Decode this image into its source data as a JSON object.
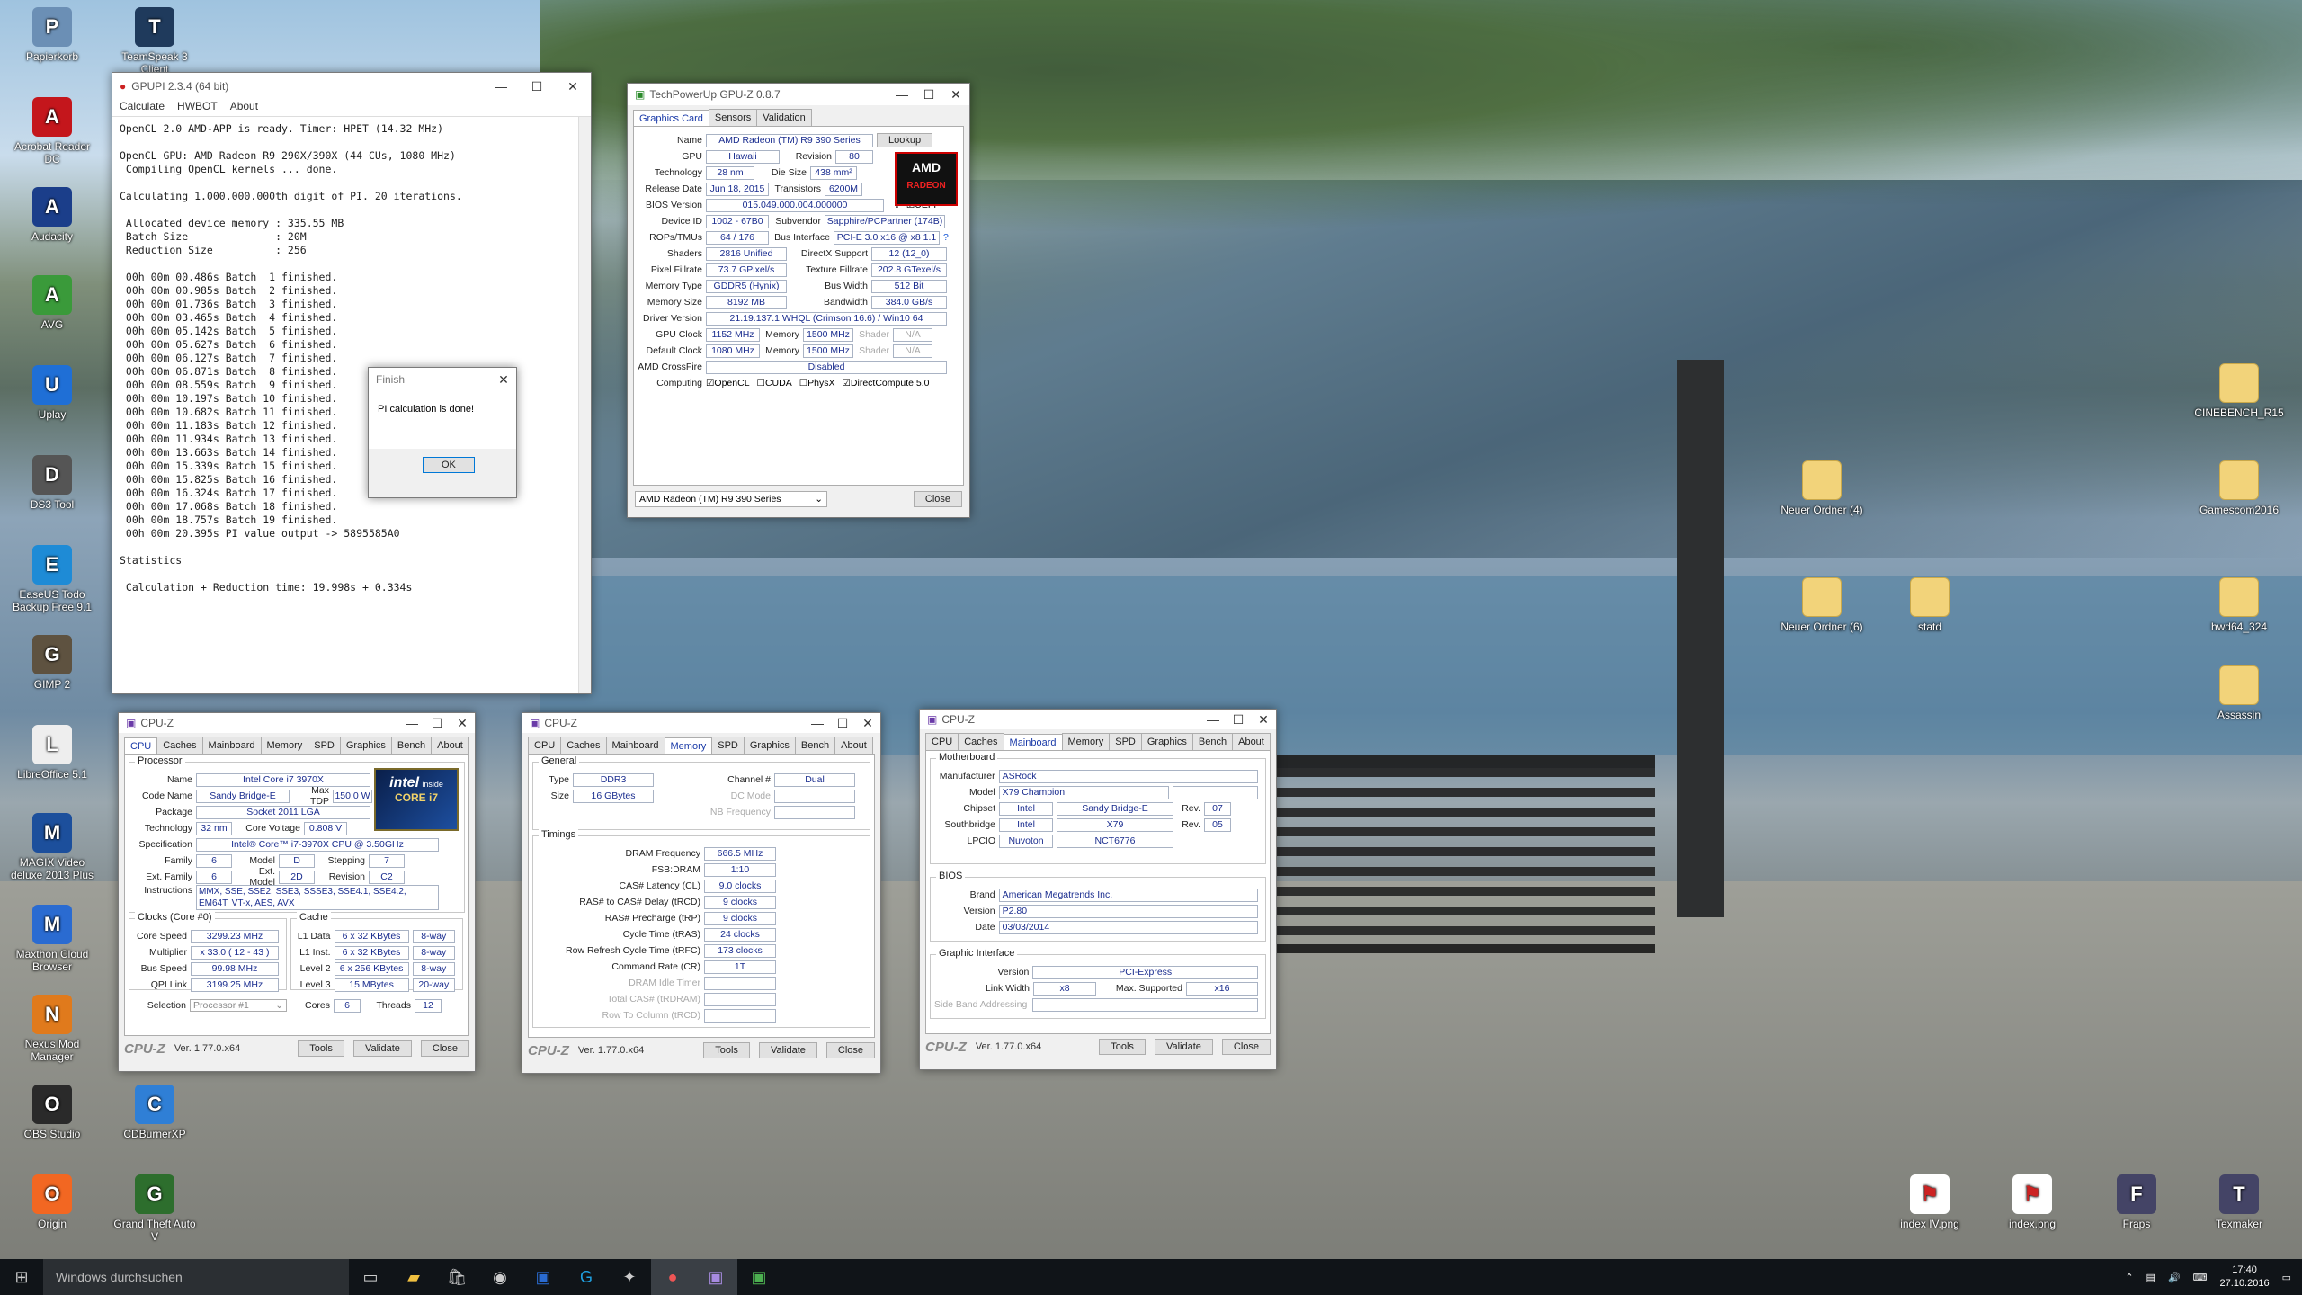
{
  "desktop": {
    "left_icons": [
      {
        "label": "Papierkorb",
        "icon": "recycle-bin-icon",
        "color": "#6b8fb5"
      },
      {
        "label": "TeamSpeak 3 Client",
        "icon": "teamspeak-icon",
        "color": "#1f3a5c"
      },
      {
        "label": "Acrobat Reader DC",
        "icon": "acrobat-icon",
        "color": "#c4161c"
      },
      {
        "label": "Audacity",
        "icon": "audacity-icon",
        "color": "#1b3e8a"
      },
      {
        "label": "AVG",
        "icon": "avg-icon",
        "color": "#3a9a3a"
      },
      {
        "label": "Uplay",
        "icon": "uplay-icon",
        "color": "#1f6fd6"
      },
      {
        "label": "DS3 Tool",
        "icon": "ds3tool-icon",
        "color": "#555555"
      },
      {
        "label": "EaseUS Todo Backup Free 9.1",
        "icon": "easeus-icon",
        "color": "#1e8bd6"
      },
      {
        "label": "GIMP 2",
        "icon": "gimp-icon",
        "color": "#5e5240"
      },
      {
        "label": "LibreOffice 5.1",
        "icon": "libreoffice-icon",
        "color": "#eeeeee"
      },
      {
        "label": "MAGIX Video deluxe 2013 Plus",
        "icon": "magix-icon",
        "color": "#1c4f9c"
      },
      {
        "label": "Maxthon Cloud Browser",
        "icon": "maxthon-icon",
        "color": "#2a6bd1"
      },
      {
        "label": "Nexus Mod Manager",
        "icon": "nexus-icon",
        "color": "#e07a1c"
      },
      {
        "label": "OBS Studio",
        "icon": "obs-icon",
        "color": "#2a2a2a"
      },
      {
        "label": "CDBurnerXP",
        "icon": "cdburnerxp-icon",
        "color": "#2f7fd6"
      },
      {
        "label": "Origin",
        "icon": "origin-icon",
        "color": "#f26722"
      },
      {
        "label": "Grand Theft Auto V",
        "icon": "gta5-icon",
        "color": "#2d6e2d"
      }
    ],
    "right_icons": [
      {
        "label": "CINEBENCH_R15",
        "icon": "folder-icon"
      },
      {
        "label": "Neuer Ordner (4)",
        "icon": "folder-icon"
      },
      {
        "label": "Gamescom2016",
        "icon": "folder-icon"
      },
      {
        "label": "Neuer Ordner (6)",
        "icon": "folder-icon"
      },
      {
        "label": "statd",
        "icon": "folder-icon"
      },
      {
        "label": "hwd64_324",
        "icon": "folder-icon"
      },
      {
        "label": "Assassin",
        "icon": "folder-icon"
      },
      {
        "label": "index IV.png",
        "icon": "image-file-icon"
      },
      {
        "label": "index.png",
        "icon": "image-file-icon"
      },
      {
        "label": "Fraps",
        "icon": "fraps-icon"
      },
      {
        "label": "Texmaker",
        "icon": "texmaker-icon"
      }
    ]
  },
  "gpupi": {
    "title": "GPUPI 2.3.4 (64 bit)",
    "menu": [
      "Calculate",
      "HWBOT",
      "About"
    ],
    "log": "OpenCL 2.0 AMD-APP is ready. Timer: HPET (14.32 MHz)\n\nOpenCL GPU: AMD Radeon R9 290X/390X (44 CUs, 1080 MHz)\n Compiling OpenCL kernels ... done.\n\nCalculating 1.000.000.000th digit of PI. 20 iterations.\n\n Allocated device memory : 335.55 MB\n Batch Size              : 20M\n Reduction Size          : 256\n\n 00h 00m 00.486s Batch  1 finished.\n 00h 00m 00.985s Batch  2 finished.\n 00h 00m 01.736s Batch  3 finished.\n 00h 00m 03.465s Batch  4 finished.\n 00h 00m 05.142s Batch  5 finished.\n 00h 00m 05.627s Batch  6 finished.\n 00h 00m 06.127s Batch  7 finished.\n 00h 00m 06.871s Batch  8 finished.\n 00h 00m 08.559s Batch  9 finished.\n 00h 00m 10.197s Batch 10 finished.\n 00h 00m 10.682s Batch 11 finished.\n 00h 00m 11.183s Batch 12 finished.\n 00h 00m 11.934s Batch 13 finished.\n 00h 00m 13.663s Batch 14 finished.\n 00h 00m 15.339s Batch 15 finished.\n 00h 00m 15.825s Batch 16 finished.\n 00h 00m 16.324s Batch 17 finished.\n 00h 00m 17.068s Batch 18 finished.\n 00h 00m 18.757s Batch 19 finished.\n 00h 00m 20.395s PI value output -> 5895585A0\n\nStatistics\n\n Calculation + Reduction time: 19.998s + 0.334s"
  },
  "finish_dialog": {
    "title": "Finish",
    "message": "PI calculation is done!",
    "ok": "OK"
  },
  "gpuz": {
    "title": "TechPowerUp GPU-Z 0.8.7",
    "tabs": [
      "Graphics Card",
      "Sensors",
      "Validation"
    ],
    "name": "AMD Radeon (TM) R9 390 Series",
    "lookup": "Lookup",
    "gpu": "Hawaii",
    "revision": "80",
    "technology": "28 nm",
    "die_size": "438 mm²",
    "release_date": "Jun 18, 2015",
    "transistors": "6200M",
    "bios_version": "015.049.000.004.000000",
    "uefi": "UEFI",
    "device_id": "1002 - 67B0",
    "subvendor": "Sapphire/PCPartner (174B)",
    "rops_tmus": "64 / 176",
    "bus_interface": "PCI-E 3.0 x16 @ x8 1.1",
    "shaders": "2816 Unified",
    "directx_support": "12 (12_0)",
    "pixel_fillrate": "73.7 GPixel/s",
    "texture_fillrate": "202.8 GTexel/s",
    "memory_type": "GDDR5 (Hynix)",
    "bus_width": "512 Bit",
    "memory_size": "8192 MB",
    "bandwidth": "384.0 GB/s",
    "driver_version": "21.19.137.1 WHQL (Crimson 16.6) / Win10 64",
    "gpu_clock": "1152 MHz",
    "memory_clock": "1500 MHz",
    "default_clock": "1080 MHz",
    "default_memory": "1500 MHz",
    "shader_na": "N/A",
    "crossfire": "Disabled",
    "computing": [
      "OpenCL",
      "CUDA",
      "PhysX",
      "DirectCompute 5.0"
    ],
    "selected_card": "AMD Radeon (TM) R9 390 Series",
    "close": "Close",
    "labels": {
      "name": "Name",
      "gpu": "GPU",
      "revision": "Revision",
      "technology": "Technology",
      "die_size": "Die Size",
      "release_date": "Release Date",
      "transistors": "Transistors",
      "bios_version": "BIOS Version",
      "device_id": "Device ID",
      "subvendor": "Subvendor",
      "rops_tmus": "ROPs/TMUs",
      "bus_interface": "Bus Interface",
      "shaders": "Shaders",
      "directx_support": "DirectX Support",
      "pixel_fillrate": "Pixel Fillrate",
      "texture_fillrate": "Texture Fillrate",
      "memory_type": "Memory Type",
      "bus_width": "Bus Width",
      "memory_size": "Memory Size",
      "bandwidth": "Bandwidth",
      "driver_version": "Driver Version",
      "gpu_clock": "GPU Clock",
      "memory": "Memory",
      "shader": "Shader",
      "default_clock": "Default Clock",
      "crossfire": "AMD CrossFire",
      "computing": "Computing"
    }
  },
  "cpuz_common": {
    "title": "CPU-Z",
    "tabs": [
      "CPU",
      "Caches",
      "Mainboard",
      "Memory",
      "SPD",
      "Graphics",
      "Bench",
      "About"
    ],
    "version": "Ver. 1.77.0.x64",
    "tools": "Tools",
    "validate": "Validate",
    "close": "Close",
    "logo": "CPU-Z"
  },
  "cpuz_cpu": {
    "processor": "Processor",
    "name": "Intel Core i7 3970X",
    "code_name": "Sandy Bridge-E",
    "max_tdp": "150.0 W",
    "package": "Socket 2011 LGA",
    "technology": "32 nm",
    "core_voltage": "0.808 V",
    "specification": "Intel® Core™ i7-3970X CPU @ 3.50GHz",
    "family": "6",
    "model": "D",
    "stepping": "7",
    "ext_family": "6",
    "ext_model": "2D",
    "revision": "C2",
    "instructions": "MMX, SSE, SSE2, SSE3, SSSE3, SSE4.1, SSE4.2, EM64T, VT-x, AES, AVX",
    "clocks_title": "Clocks (Core #0)",
    "core_speed": "3299.23 MHz",
    "multiplier": "x 33.0 ( 12 - 43 )",
    "bus_speed": "99.98 MHz",
    "qpi_link": "3199.25 MHz",
    "cache_title": "Cache",
    "l1_data": "6 x 32 KBytes",
    "l1_data_way": "8-way",
    "l1_inst": "6 x 32 KBytes",
    "l1_inst_way": "8-way",
    "level2": "6 x 256 KBytes",
    "level2_way": "8-way",
    "level3": "15 MBytes",
    "level3_way": "20-way",
    "selection": "Processor #1",
    "cores": "6",
    "threads": "12",
    "badge_line1": "intel",
    "badge_line2": "inside",
    "badge_line3": "CORE i7",
    "labels": {
      "name": "Name",
      "code_name": "Code Name",
      "max_tdp": "Max TDP",
      "package": "Package",
      "technology": "Technology",
      "core_voltage": "Core Voltage",
      "specification": "Specification",
      "family": "Family",
      "model": "Model",
      "stepping": "Stepping",
      "ext_family": "Ext. Family",
      "ext_model": "Ext. Model",
      "revision": "Revision",
      "instructions": "Instructions",
      "core_speed": "Core Speed",
      "multiplier": "Multiplier",
      "bus_speed": "Bus Speed",
      "qpi_link": "QPI Link",
      "l1_data": "L1 Data",
      "l1_inst": "L1 Inst.",
      "level2": "Level 2",
      "level3": "Level 3",
      "selection": "Selection",
      "cores": "Cores",
      "threads": "Threads"
    }
  },
  "cpuz_memory": {
    "general": "General",
    "type": "DDR3",
    "size": "16 GBytes",
    "channel": "Dual",
    "timings": "Timings",
    "dram_frequency": "666.5 MHz",
    "fsb_dram": "1:10",
    "cas_latency": "9.0 clocks",
    "ras_to_cas": "9 clocks",
    "ras_precharge": "9 clocks",
    "cycle_time": "24 clocks",
    "row_refresh": "173 clocks",
    "command_rate": "1T",
    "labels": {
      "type": "Type",
      "size": "Size",
      "channel": "Channel #",
      "dc_mode": "DC Mode",
      "nb_frequency": "NB Frequency",
      "dram_frequency": "DRAM Frequency",
      "fsb_dram": "FSB:DRAM",
      "cas_latency": "CAS# Latency (CL)",
      "ras_to_cas": "RAS# to CAS# Delay (tRCD)",
      "ras_precharge": "RAS# Precharge (tRP)",
      "cycle_time": "Cycle Time (tRAS)",
      "row_refresh": "Row Refresh Cycle Time (tRFC)",
      "command_rate": "Command Rate (CR)",
      "idle_timer": "DRAM Idle Timer",
      "total_cas": "Total CAS# (tRDRAM)",
      "row_to_column": "Row To Column (tRCD)"
    }
  },
  "cpuz_mainboard": {
    "motherboard": "Motherboard",
    "manufacturer": "ASRock",
    "model": "X79 Champion",
    "chipset_vendor": "Intel",
    "chipset": "Sandy Bridge-E",
    "chipset_rev": "07",
    "southbridge_vendor": "Intel",
    "southbridge": "X79",
    "southbridge_rev": "05",
    "lpcio_vendor": "Nuvoton",
    "lpcio": "NCT6776",
    "bios": "BIOS",
    "brand": "American Megatrends Inc.",
    "bios_version": "P2.80",
    "date": "03/03/2014",
    "graphic_interface": "Graphic Interface",
    "gi_version": "PCI-Express",
    "link_width": "x8",
    "max_supported": "x16",
    "labels": {
      "manufacturer": "Manufacturer",
      "model": "Model",
      "chipset": "Chipset",
      "southbridge": "Southbridge",
      "lpcio": "LPCIO",
      "rev": "Rev.",
      "brand": "Brand",
      "version": "Version",
      "date": "Date",
      "link_width": "Link Width",
      "max_supported": "Max. Supported",
      "side_band": "Side Band Addressing"
    }
  },
  "taskbar": {
    "search_placeholder": "Windows durchsuchen",
    "time": "17:40",
    "date": "27.10.2016"
  }
}
